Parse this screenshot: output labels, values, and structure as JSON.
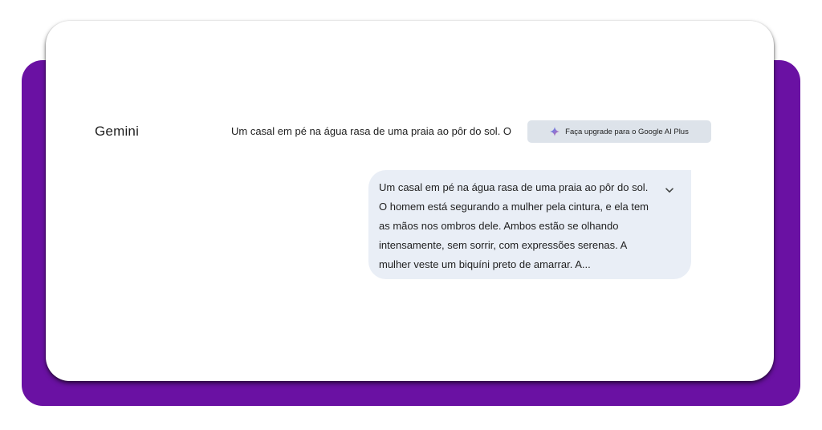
{
  "app": {
    "brand": "Gemini"
  },
  "header": {
    "prompt_preview": "Um casal em pé na água rasa de uma praia ao pôr do sol. O",
    "upgrade_label": "Faça upgrade para o Google AI Plus",
    "upgrade_icon": "gemini-sparkle-icon"
  },
  "message": {
    "text": "Um casal em pé na água rasa de uma praia ao pôr do sol. O homem está segurando a mulher pela cintura, e ela tem as mãos nos ombros dele. Ambos estão se olhando intensamente, sem sorrir, com expressões serenas. A mulher veste um biquíni preto de amarrar. A...",
    "expand_icon": "chevron-down-icon"
  },
  "colors": {
    "accent_purple": "#6a11a3",
    "bubble_bg": "#e9eef6",
    "button_bg": "#dde3ea"
  }
}
